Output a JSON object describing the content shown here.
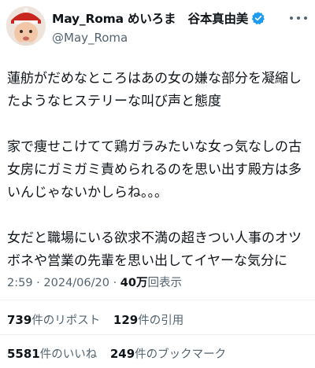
{
  "user": {
    "display_name": "May_Roma めいろま　谷本真由美",
    "handle": "@May_Roma"
  },
  "tweet": {
    "paragraphs": [
      "蓮舫がだめなところはあの女の嫌な部分を凝縮し\nたようなヒステリーな叫び声と態度",
      "家で痩せこけてて鶏ガラみたいな女っ気なしの古\n女房にガミガミ責められるのを思い出す殿方は多\nいんじゃないかしらね。。。",
      "女だと職場にいる欲求不満の超きつい人事のオツ\nボネや営業の先輩を思い出してイヤーな気分に"
    ]
  },
  "meta": {
    "time": "2:59",
    "separator": " · ",
    "date": "2024/06/20",
    "views_count": "40万",
    "views_label": "回表示"
  },
  "stats": {
    "retweets_count": "739",
    "retweets_label": "件のリポスト",
    "quotes_count": "129",
    "quotes_label": "件の引用",
    "likes_count": "5581",
    "likes_label": "件のいいね",
    "bookmarks_count": "249",
    "bookmarks_label": "件のブックマーク"
  },
  "icons": {
    "verified": "verified-badge-icon",
    "more": "more-options-icon"
  },
  "colors": {
    "verified": "#1d9bf0",
    "secondary_text": "#536471",
    "divider": "#eff3f4"
  }
}
